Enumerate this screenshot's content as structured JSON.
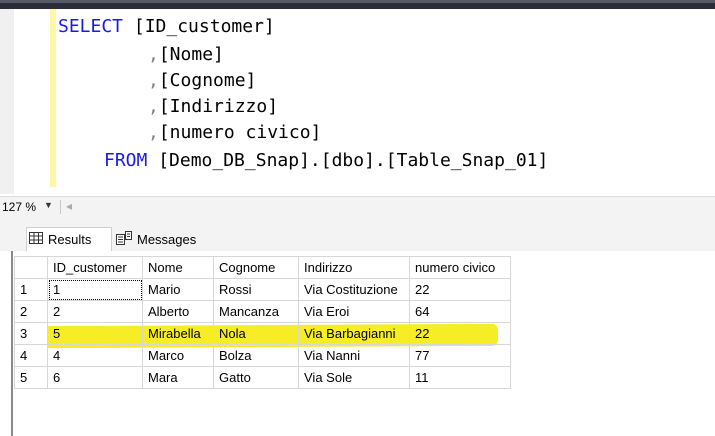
{
  "editor": {
    "lines": [
      {
        "indent": "      ",
        "kw": "SELECT",
        "text": " [ID_customer]"
      },
      {
        "indent": "            ",
        "comma": ",",
        "text": "[Nome]"
      },
      {
        "indent": "            ",
        "comma": ",",
        "text": "[Cognome]"
      },
      {
        "indent": "            ",
        "comma": ",",
        "text": "[Indirizzo]"
      },
      {
        "indent": "            ",
        "comma": ",",
        "text": "[numero civico]"
      },
      {
        "indent": "        ",
        "kw": "FROM",
        "text": " [Demo_DB_Snap].[dbo].[Table_Snap_01]"
      }
    ]
  },
  "zoom": {
    "value": "127 %"
  },
  "tabs": {
    "results": "Results",
    "messages": "Messages"
  },
  "grid": {
    "columns": [
      "ID_customer",
      "Nome",
      "Cognome",
      "Indirizzo",
      "numero civico"
    ],
    "rows": [
      {
        "n": "1",
        "cells": [
          "1",
          "Mario",
          "Rossi",
          "Via Costituzione",
          "22"
        ]
      },
      {
        "n": "2",
        "cells": [
          "2",
          "Alberto",
          "Mancanza",
          "Via Eroi",
          "64"
        ]
      },
      {
        "n": "3",
        "cells": [
          "5",
          "Mirabella",
          "Nola",
          "Via Barbagianni",
          "22"
        ]
      },
      {
        "n": "4",
        "cells": [
          "4",
          "Marco",
          "Bolza",
          "Via Nanni",
          "77"
        ]
      },
      {
        "n": "5",
        "cells": [
          "6",
          "Mara",
          "Gatto",
          "Via Sole",
          "11"
        ]
      }
    ],
    "highlight_color": "#f7ec1a"
  }
}
